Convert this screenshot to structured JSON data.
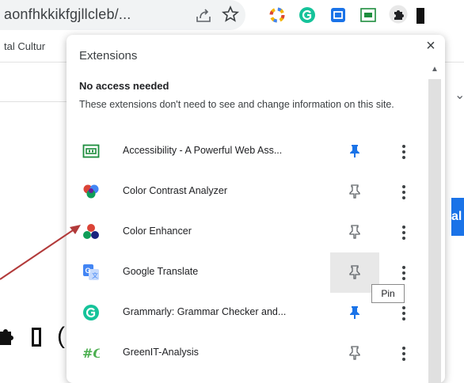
{
  "browser": {
    "url_text": "aonfhkkikfgjllcleb/...",
    "bookmark_text": "tal Cultur",
    "right_button_text": "al"
  },
  "popup": {
    "title": "Extensions",
    "close_label": "×",
    "section_heading": "No access needed",
    "section_description": "These extensions don't need to see and change information on this site.",
    "items": [
      {
        "name": "Accessibility - A Powerful Web Ass...",
        "icon": "accessibility-icon",
        "pinned": true
      },
      {
        "name": "Color Contrast Analyzer",
        "icon": "color-contrast-icon",
        "pinned": false
      },
      {
        "name": "Color Enhancer",
        "icon": "color-enhancer-icon",
        "pinned": false
      },
      {
        "name": "Google Translate",
        "icon": "google-translate-icon",
        "pinned": false
      },
      {
        "name": "Grammarly: Grammar Checker and...",
        "icon": "grammarly-icon",
        "pinned": true
      },
      {
        "name": "GreenIT-Analysis",
        "icon": "greenit-icon",
        "pinned": false
      }
    ],
    "tooltip": "Pin"
  },
  "colors": {
    "pinned_blue": "#1a73e8",
    "unpinned_gray": "#5f6368",
    "arrow_red": "#b23a3a"
  }
}
